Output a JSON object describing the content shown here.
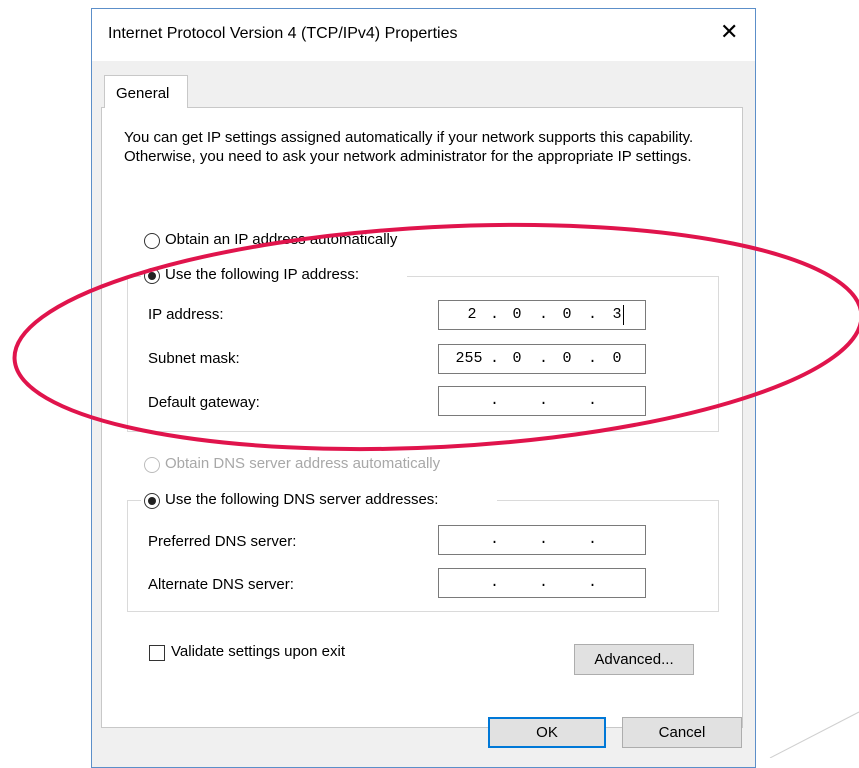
{
  "dialog": {
    "title": "Internet Protocol Version 4 (TCP/IPv4) Properties",
    "close_icon": "close-icon"
  },
  "tabs": [
    {
      "label": "General",
      "selected": true
    }
  ],
  "description": "You can get IP settings assigned automatically if your network supports this capability. Otherwise, you need to ask your network administrator for the appropriate IP settings.",
  "ip_section": {
    "auto_option": {
      "label": "Obtain an IP address automatically",
      "checked": false
    },
    "manual_option": {
      "label": "Use the following IP address:",
      "checked": true
    },
    "fields": {
      "ip_address": {
        "label": "IP address:",
        "octets": [
          "2",
          "0",
          "0",
          "3"
        ]
      },
      "subnet_mask": {
        "label": "Subnet mask:",
        "octets": [
          "255",
          "0",
          "0",
          "0"
        ]
      },
      "default_gateway": {
        "label": "Default gateway:",
        "octets": [
          "",
          "",
          "",
          ""
        ]
      }
    }
  },
  "dns_section": {
    "auto_option": {
      "label": "Obtain DNS server address automatically",
      "checked": false,
      "disabled": true
    },
    "manual_option": {
      "label": "Use the following DNS server addresses:",
      "checked": true
    },
    "fields": {
      "preferred": {
        "label": "Preferred DNS server:",
        "octets": [
          "",
          "",
          "",
          ""
        ]
      },
      "alternate": {
        "label": "Alternate DNS server:",
        "octets": [
          "",
          "",
          "",
          ""
        ]
      }
    }
  },
  "validate": {
    "label": "Validate settings upon exit",
    "checked": false
  },
  "buttons": {
    "advanced": "Advanced...",
    "ok": "OK",
    "cancel": "Cancel"
  },
  "annotation": {
    "color": "#e0144c",
    "shape": "ellipse highlight"
  },
  "colors": {
    "dialog_border": "#5c8fc9",
    "default_button_border": "#0078d7",
    "face": "#f0f0f0"
  }
}
